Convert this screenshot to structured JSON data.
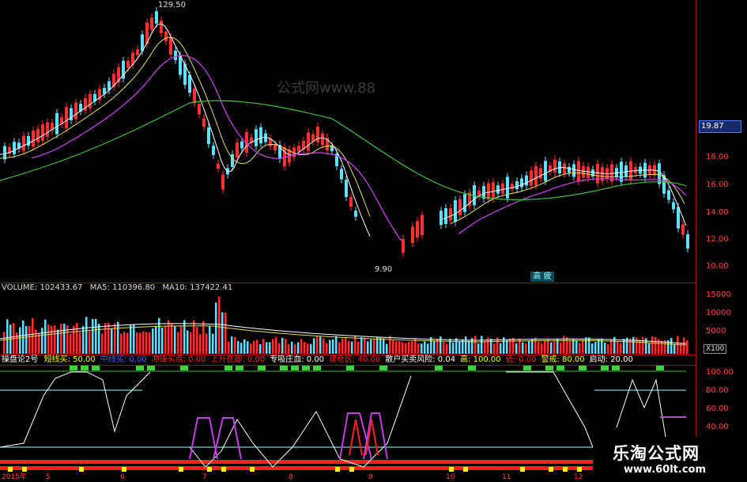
{
  "price_axis": [
    "19.87",
    "18.00",
    "16.00",
    "14.00",
    "12.00",
    "10.00"
  ],
  "price_axis_current": "19.87",
  "high_label": "129.50",
  "low_label": "9.90",
  "gao_label": "高 疲",
  "ghost_text": "公式网www.88",
  "volume": {
    "label": "VOLUME:",
    "value": "102433.67",
    "ma5_label": "MA5:",
    "ma5": "110396.80",
    "ma10_label": "MA10:",
    "ma10": "137422.41",
    "axis": [
      "15000",
      "10000",
      "5000"
    ],
    "unit": "X100"
  },
  "indicator": {
    "name": "操盘论2号",
    "items": [
      {
        "label": "短线买:",
        "value": "50.00",
        "color": "#ffff00"
      },
      {
        "label": "中线买:",
        "value": "0.00",
        "color": "#4060ff"
      },
      {
        "label": "冲锋买点:",
        "value": "0.00",
        "color": "#ff2020"
      },
      {
        "label": "上升在即:",
        "value": "0.00",
        "color": "#ff2020"
      },
      {
        "label": "专吸庄血:",
        "value": "0.00",
        "color": "#ffffff"
      },
      {
        "label": "建仓区:",
        "value": "40.00",
        "color": "#ff2020"
      },
      {
        "label": "散户买卖风险:",
        "value": "0.04",
        "color": "#ffffff"
      },
      {
        "label": "高:",
        "value": "100.00",
        "color": "#ffff00"
      },
      {
        "label": "低:",
        "value": "0.00",
        "color": "#ff2020"
      },
      {
        "label": "警戒:",
        "value": "80.00",
        "color": "#ffff00"
      },
      {
        "label": "启动:",
        "value": "20.00",
        "color": "#ffffff"
      }
    ],
    "axis": [
      "100.00",
      "80.00",
      "60.00",
      "40.00"
    ]
  },
  "time_axis": [
    "2015年",
    "5",
    "6",
    "7",
    "8",
    "9",
    "10",
    "11",
    "12"
  ],
  "watermark": {
    "cn": "乐淘公式网",
    "url": "www.60lt.com"
  },
  "colors": {
    "up": "#ff3030",
    "down": "#60e0ff",
    "ma_white": "#ffffff",
    "ma_yellow": "#e0e060",
    "ma_purple": "#c040e0",
    "ma_green": "#40c040"
  }
}
